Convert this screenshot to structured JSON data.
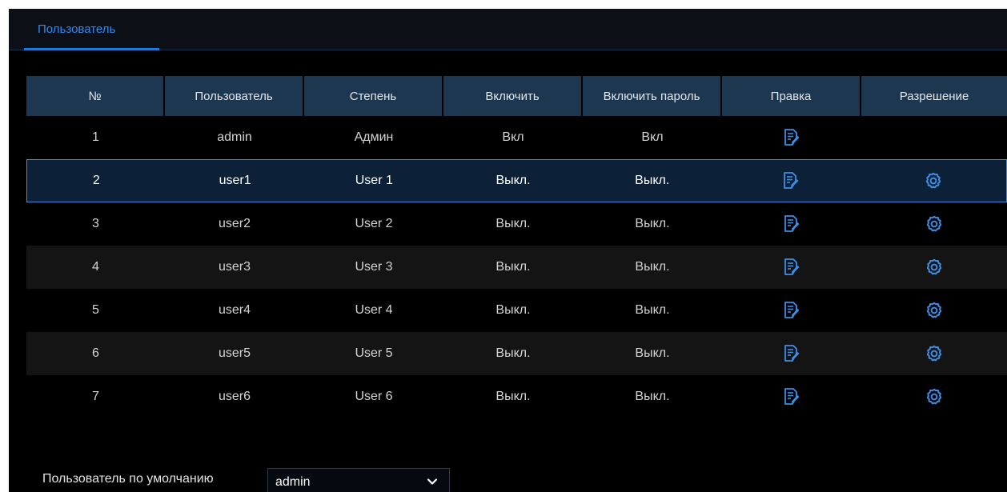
{
  "tabs": [
    {
      "label": "Пользователь",
      "active": true
    }
  ],
  "table": {
    "columns": [
      "№",
      "Пользователь",
      "Степень",
      "Включить",
      "Включить пароль",
      "Правка",
      "Разрешение"
    ],
    "rows": [
      {
        "no": "1",
        "user": "admin",
        "level": "Админ",
        "enable": "Вкл",
        "password": "Вкл",
        "edit_icon": "edit-icon",
        "permission_icon": null,
        "selected": false
      },
      {
        "no": "2",
        "user": "user1",
        "level": "User 1",
        "enable": "Выкл.",
        "password": "Выкл.",
        "edit_icon": "edit-icon",
        "permission_icon": "gear-icon",
        "selected": true
      },
      {
        "no": "3",
        "user": "user2",
        "level": "User 2",
        "enable": "Выкл.",
        "password": "Выкл.",
        "edit_icon": "edit-icon",
        "permission_icon": "gear-icon",
        "selected": false
      },
      {
        "no": "4",
        "user": "user3",
        "level": "User 3",
        "enable": "Выкл.",
        "password": "Выкл.",
        "edit_icon": "edit-icon",
        "permission_icon": "gear-icon",
        "selected": false
      },
      {
        "no": "5",
        "user": "user4",
        "level": "User 4",
        "enable": "Выкл.",
        "password": "Выкл.",
        "edit_icon": "edit-icon",
        "permission_icon": "gear-icon",
        "selected": false
      },
      {
        "no": "6",
        "user": "user5",
        "level": "User 5",
        "enable": "Выкл.",
        "password": "Выкл.",
        "edit_icon": "edit-icon",
        "permission_icon": "gear-icon",
        "selected": false
      },
      {
        "no": "7",
        "user": "user6",
        "level": "User 6",
        "enable": "Выкл.",
        "password": "Выкл.",
        "edit_icon": "edit-icon",
        "permission_icon": "gear-icon",
        "selected": false
      }
    ]
  },
  "footer": {
    "default_user_label": "Пользователь по умолчанию",
    "default_user_value": "admin",
    "dropdown_icon": "chevron-down-icon"
  },
  "colors": {
    "accent": "#2a8cf2",
    "header_bg": "#1d3751",
    "selected_border": "#3b8ee0",
    "background": "#000000"
  }
}
